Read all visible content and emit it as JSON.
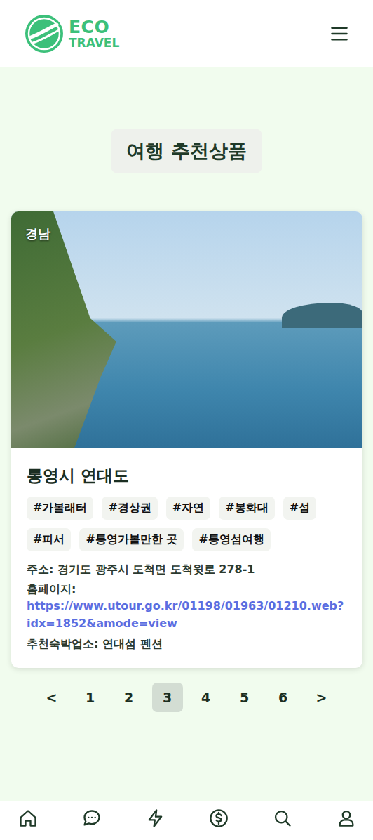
{
  "header": {
    "logo_line1": "ECO",
    "logo_line2": "TRAVEL"
  },
  "page_title": "여행 추천상품",
  "card": {
    "region": "경남",
    "title": "통영시 연대도",
    "tags": [
      "#가볼래터",
      "#경상권",
      "#자연",
      "#봉화대",
      "#섬",
      "#피서",
      "#통영가볼만한 곳",
      "#통영섬여행"
    ],
    "address": "주소: 경기도 광주시 도척면 도척윗로 278-1",
    "homepage_label": "홈페이지:",
    "homepage_url": "https://www.utour.go.kr/01198/01963/01210.web?idx=1852&amode=view",
    "lodging": "추천숙박업소: 연대섬 펜션"
  },
  "pagination": {
    "prev": "<",
    "next": ">",
    "pages": [
      {
        "label": "1",
        "selected": false
      },
      {
        "label": "2",
        "selected": false
      },
      {
        "label": "3",
        "selected": true
      },
      {
        "label": "4",
        "selected": false
      },
      {
        "label": "5",
        "selected": false
      },
      {
        "label": "6",
        "selected": false
      }
    ]
  }
}
